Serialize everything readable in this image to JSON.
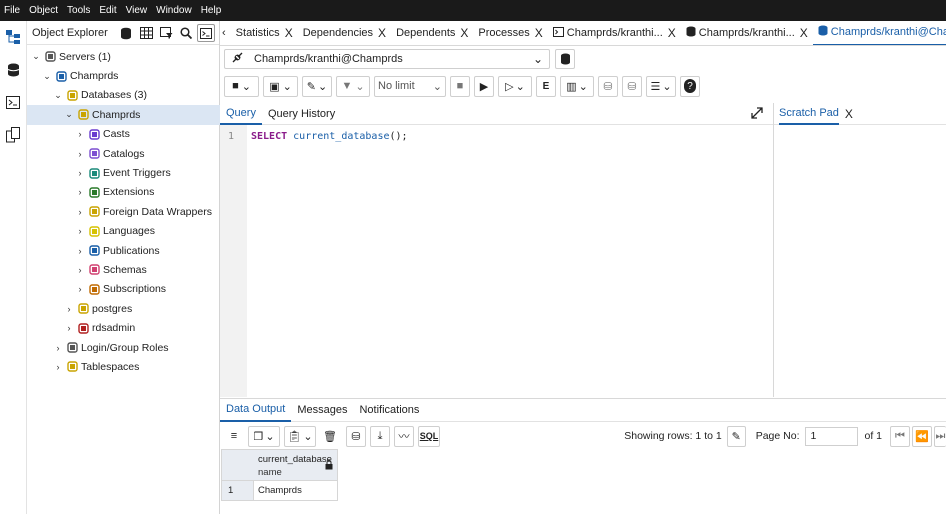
{
  "menu": [
    "File",
    "Object",
    "Tools",
    "Edit",
    "View",
    "Window",
    "Help"
  ],
  "explorer": {
    "title": "Object Explorer",
    "tree": [
      {
        "label": "Servers (1)",
        "level": 0,
        "state": "open",
        "icon": "servers-icon"
      },
      {
        "label": "Champrds",
        "level": 1,
        "state": "open",
        "icon": "server-icon"
      },
      {
        "label": "Databases (3)",
        "level": 2,
        "state": "open",
        "icon": "databases-icon"
      },
      {
        "label": "Champrds",
        "level": 3,
        "state": "open",
        "icon": "database-icon",
        "selected": true
      },
      {
        "label": "Casts",
        "level": 4,
        "state": "closed",
        "icon": "casts-icon"
      },
      {
        "label": "Catalogs",
        "level": 4,
        "state": "closed",
        "icon": "catalogs-icon"
      },
      {
        "label": "Event Triggers",
        "level": 4,
        "state": "closed",
        "icon": "event-triggers-icon"
      },
      {
        "label": "Extensions",
        "level": 4,
        "state": "closed",
        "icon": "extensions-icon"
      },
      {
        "label": "Foreign Data Wrappers",
        "level": 4,
        "state": "closed",
        "icon": "fdw-icon"
      },
      {
        "label": "Languages",
        "level": 4,
        "state": "closed",
        "icon": "languages-icon"
      },
      {
        "label": "Publications",
        "level": 4,
        "state": "closed",
        "icon": "publications-icon"
      },
      {
        "label": "Schemas",
        "level": 4,
        "state": "closed",
        "icon": "schemas-icon"
      },
      {
        "label": "Subscriptions",
        "level": 4,
        "state": "closed",
        "icon": "subscriptions-icon"
      },
      {
        "label": "postgres",
        "level": 3,
        "state": "closed",
        "icon": "database-icon"
      },
      {
        "label": "rdsadmin",
        "level": 3,
        "state": "closed",
        "icon": "database-locked-icon"
      },
      {
        "label": "Login/Group Roles",
        "level": 2,
        "state": "closed",
        "icon": "roles-icon"
      },
      {
        "label": "Tablespaces",
        "level": 2,
        "state": "closed",
        "icon": "tablespaces-icon"
      }
    ]
  },
  "tabs": [
    {
      "label": "Statistics",
      "close": "X"
    },
    {
      "label": "Dependencies",
      "close": "X"
    },
    {
      "label": "Dependents",
      "close": "X"
    },
    {
      "label": "Processes",
      "close": "X"
    },
    {
      "label": "Champrds/kranthi...",
      "close": "X",
      "icon": "query-tool-icon"
    },
    {
      "label": "Champrds/kranthi...",
      "close": "X",
      "icon": "database-icon"
    },
    {
      "label": "Champrds/kranthi@Champrds*",
      "close": "X",
      "icon": "database-icon",
      "active": true
    }
  ],
  "connection": {
    "label": "Champrds/kranthi@Champrds"
  },
  "toolbar": {
    "limit_label": "No limit"
  },
  "query_tabs": {
    "query": "Query",
    "history": "Query History"
  },
  "editor": {
    "line_no": "1",
    "keyword": "SELECT",
    "function": "current_database",
    "rest": "();"
  },
  "scratch": {
    "label": "Scratch Pad",
    "close": "X"
  },
  "output_tabs": {
    "data": "Data Output",
    "messages": "Messages",
    "notifications": "Notifications"
  },
  "output_bar": {
    "rows_label": "Showing rows: 1 to 1",
    "page_label": "Page No:",
    "page_value": "1",
    "of_label": "of 1"
  },
  "grid": {
    "column": "current_database",
    "type": "name",
    "row_num": "1",
    "value": "Champrds"
  }
}
